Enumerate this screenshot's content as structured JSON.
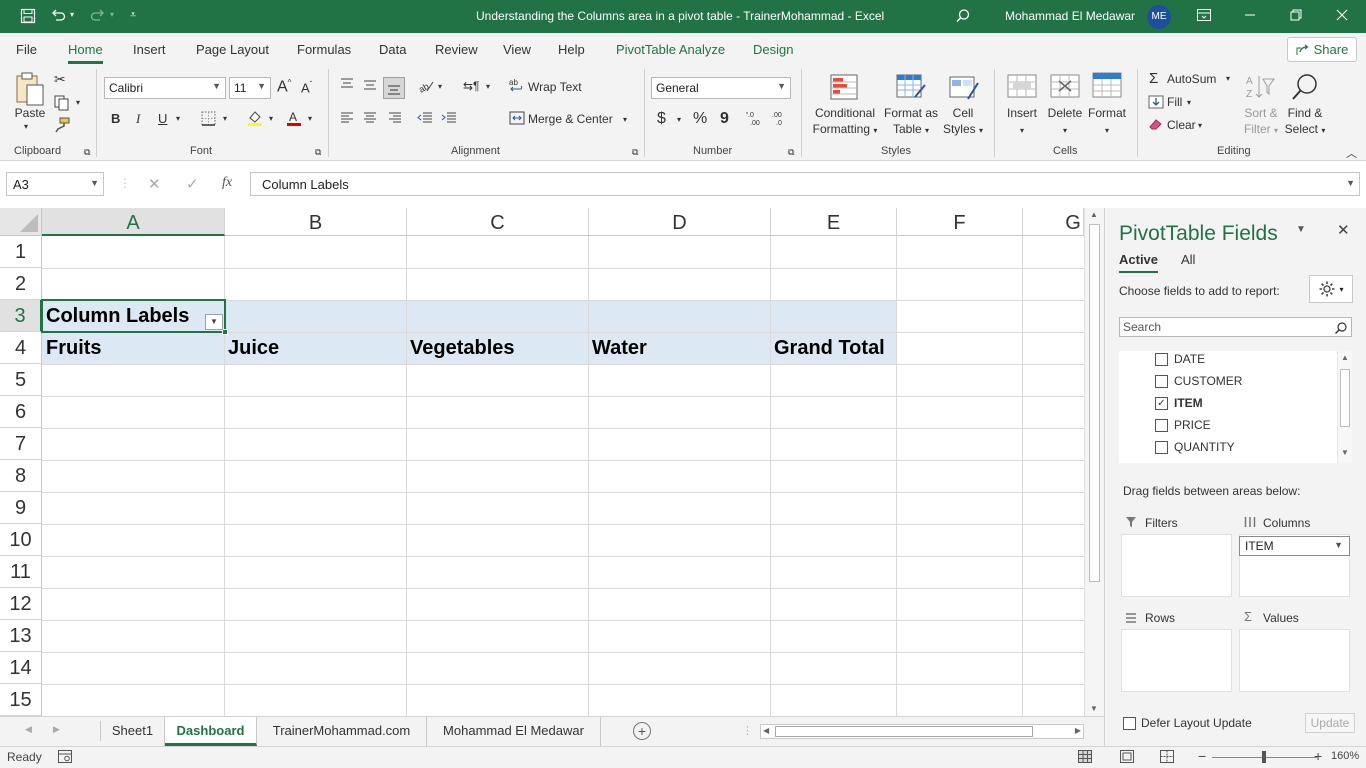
{
  "window": {
    "title": "Understanding the Columns area in a pivot table - TrainerMohammad  -  Excel",
    "user_name": "Mohammad El Medawar",
    "user_initials": "ME"
  },
  "menu": {
    "tabs": [
      "File",
      "Home",
      "Insert",
      "Page Layout",
      "Formulas",
      "Data",
      "Review",
      "View",
      "Help",
      "PivotTable Analyze",
      "Design"
    ],
    "share": "Share"
  },
  "ribbon": {
    "clipboard": {
      "paste": "Paste",
      "group": "Clipboard"
    },
    "font": {
      "name": "Calibri",
      "size": "11",
      "group": "Font"
    },
    "alignment": {
      "wrap_text": "Wrap Text",
      "merge_center": "Merge & Center",
      "group": "Alignment"
    },
    "number": {
      "format": "General",
      "currency": "$",
      "percent": "%",
      "comma": "9",
      "group": "Number"
    },
    "styles": {
      "conditional_1": "Conditional",
      "conditional_2": "Formatting",
      "format_table_1": "Format as",
      "format_table_2": "Table",
      "cell_styles_1": "Cell",
      "cell_styles_2": "Styles",
      "group": "Styles"
    },
    "cells": {
      "insert": "Insert",
      "delete": "Delete",
      "format": "Format",
      "group": "Cells"
    },
    "editing": {
      "autosum": "AutoSum",
      "fill": "Fill",
      "clear": "Clear",
      "sort_1": "Sort &",
      "sort_2": "Filter",
      "find_1": "Find &",
      "find_2": "Select",
      "group": "Editing"
    }
  },
  "formula_bar": {
    "name_box": "A3",
    "fx": "fx",
    "content": "Column Labels"
  },
  "grid": {
    "columns": [
      "A",
      "B",
      "C",
      "D",
      "E",
      "F",
      "G"
    ],
    "rows": [
      "1",
      "2",
      "3",
      "4",
      "5",
      "6",
      "7",
      "8",
      "9",
      "10",
      "11",
      "12",
      "13",
      "14",
      "15"
    ],
    "cells": {
      "a3": "Column Labels",
      "a4": "Fruits",
      "b4": "Juice",
      "c4": "Vegetables",
      "d4": "Water",
      "e4": "Grand Total"
    }
  },
  "sheets": {
    "tabs": [
      "Sheet1",
      "Dashboard",
      "TrainerMohammad.com",
      "Mohammad El Medawar"
    ],
    "active": "Dashboard"
  },
  "status": {
    "ready": "Ready",
    "zoom": "160%"
  },
  "pivot_pane": {
    "title": "PivotTable Fields",
    "tab_active": "Active",
    "tab_all": "All",
    "choose_label": "Choose fields to add to report:",
    "search_placeholder": "Search",
    "fields": [
      {
        "name": "DATE",
        "checked": false
      },
      {
        "name": "CUSTOMER",
        "checked": false
      },
      {
        "name": "ITEM",
        "checked": true
      },
      {
        "name": "PRICE",
        "checked": false
      },
      {
        "name": "QUANTITY",
        "checked": false
      }
    ],
    "drag_label": "Drag fields between areas below:",
    "areas": {
      "filters": "Filters",
      "columns": "Columns",
      "rows": "Rows",
      "values": "Values"
    },
    "columns_item": "ITEM",
    "defer_label": "Defer Layout Update",
    "update": "Update"
  },
  "colors": {
    "accent": "#217346",
    "pivot_band": "#dce9f5"
  }
}
